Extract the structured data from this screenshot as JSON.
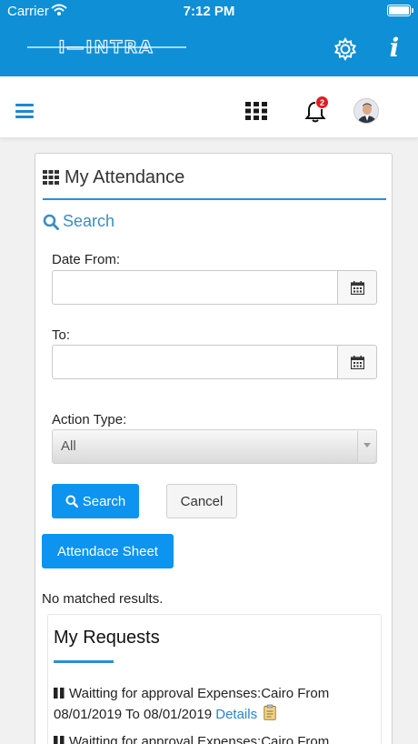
{
  "status_bar": {
    "carrier": "Carrier",
    "time": "7:12 PM"
  },
  "app_bar": {
    "logo_text": "INTRA"
  },
  "toolbar": {
    "notification_count": "2"
  },
  "attendance": {
    "title": "My Attendance",
    "search_heading": "Search",
    "date_from_label": "Date From:",
    "date_from_value": "",
    "to_label": "To:",
    "to_value": "",
    "action_type_label": "Action Type:",
    "action_type_selected": "All",
    "search_button": "Search",
    "cancel_button": "Cancel",
    "attendance_sheet_button": "Attendace Sheet",
    "no_results": "No matched results."
  },
  "requests": {
    "title": "My Requests",
    "items": [
      {
        "text": "Waitting for approval Expenses:Cairo From 08/01/2019 To 08/01/2019",
        "link": "Details"
      },
      {
        "text": "Waitting for approval Expenses:Cairo From",
        "link": ""
      }
    ]
  },
  "colors": {
    "primary": "#0f8fd6",
    "button": "#0d93f0",
    "accent_rule": "#2a8ed8",
    "badge": "#e31b23"
  }
}
